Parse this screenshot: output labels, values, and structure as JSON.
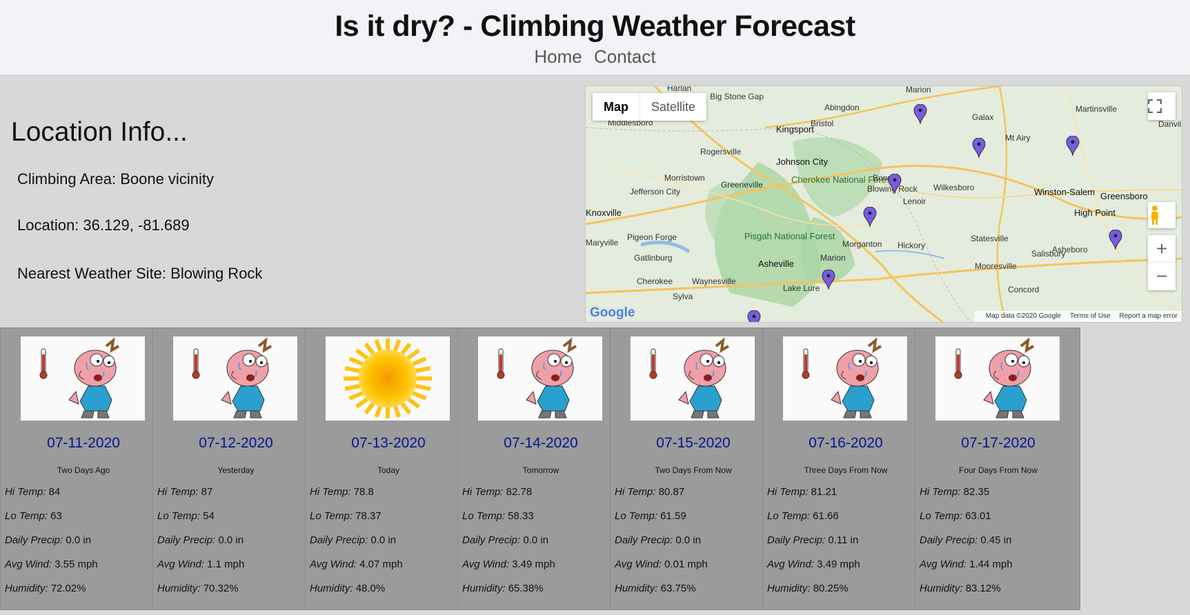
{
  "header": {
    "title": "Is it dry? - Climbing Weather Forecast",
    "nav": [
      "Home",
      "Contact"
    ]
  },
  "info": {
    "heading": "Location Info...",
    "area_label": "Climbing Area:",
    "area": "Boone vicinity",
    "location_label": "Location:",
    "location": "36.129, -81.689",
    "site_label": "Nearest Weather Site:",
    "site": "Blowing Rock"
  },
  "map": {
    "map_btn": "Map",
    "satellite_btn": "Satellite",
    "google": "Google",
    "attrib_data": "Map data ©2020 Google",
    "attrib_terms": "Terms of Use",
    "attrib_report": "Report a map error",
    "labels": [
      "Harlan",
      "Big Stone Gap",
      "Abingdon",
      "Marion",
      "Martinsville",
      "Danvill",
      "Middlesboro",
      "Kingsport",
      "Bristol",
      "Galax",
      "Mt Airy",
      "Rogersville",
      "Johnson City",
      "Morristown",
      "Cherokee National Forest",
      "Boone",
      "Blowing Rock",
      "Wilkesboro",
      "Winston-Salem",
      "Greensboro",
      "Jefferson City",
      "Greeneville",
      "Knoxville",
      "High Point",
      "Pigeon Forge",
      "Lenoir",
      "Pisgah National Forest",
      "Morganton",
      "Hickory",
      "Statesville",
      "Maryville",
      "Gatlinburg",
      "Marion",
      "Asheville",
      "Mooresville",
      "Salisbury",
      "Asheboro",
      "Cherokee",
      "Waynesville",
      "Lake Lure",
      "Concord",
      "Sylva"
    ]
  },
  "labels": {
    "hi": "Hi Temp:",
    "lo": "Lo Temp:",
    "precip": "Daily Precip:",
    "wind": "Avg Wind:",
    "humidity": "Humidity:"
  },
  "forecast": [
    {
      "date": "07-11-2020",
      "relative": "Two Days Ago",
      "icon": "hot-man-icon",
      "hi": "84",
      "lo": "63",
      "precip": "0.0 in",
      "wind": "3.55 mph",
      "humidity": "72.02%"
    },
    {
      "date": "07-12-2020",
      "relative": "Yesterday",
      "icon": "hot-man-icon",
      "hi": "87",
      "lo": "54",
      "precip": "0.0 in",
      "wind": "1.1 mph",
      "humidity": "70.32%"
    },
    {
      "date": "07-13-2020",
      "relative": "Today",
      "icon": "sun-icon",
      "hi": "78.8",
      "lo": "78.37",
      "precip": "0.0 in",
      "wind": "4.07 mph",
      "humidity": "48.0%"
    },
    {
      "date": "07-14-2020",
      "relative": "Tomorrow",
      "icon": "hot-man-icon",
      "hi": "82.78",
      "lo": "58.33",
      "precip": "0.0 in",
      "wind": "3.49 mph",
      "humidity": "65.38%"
    },
    {
      "date": "07-15-2020",
      "relative": "Two Days From Now",
      "icon": "hot-man-icon",
      "hi": "80.87",
      "lo": "61.59",
      "precip": "0.0 in",
      "wind": "0.01 mph",
      "humidity": "63.75%"
    },
    {
      "date": "07-16-2020",
      "relative": "Three Days From Now",
      "icon": "hot-man-icon",
      "hi": "81.21",
      "lo": "61.66",
      "precip": "0.11 in",
      "wind": "3.49 mph",
      "humidity": "80.25%"
    },
    {
      "date": "07-17-2020",
      "relative": "Four Days From Now",
      "icon": "hot-man-icon",
      "hi": "82.35",
      "lo": "63.01",
      "precip": "0.45 in",
      "wind": "1.44 mph",
      "humidity": "83.12%"
    }
  ]
}
